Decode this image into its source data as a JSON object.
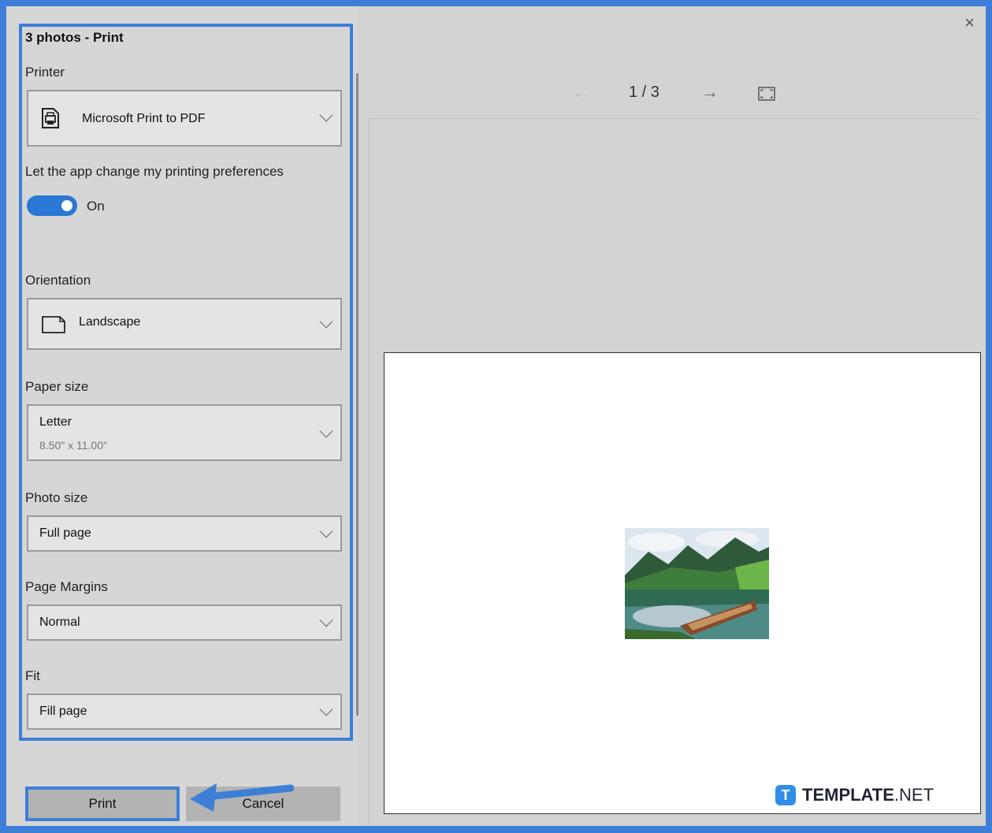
{
  "dialog": {
    "title": "3 photos - Print",
    "close": "×"
  },
  "printer": {
    "label": "Printer",
    "value": "Microsoft Print to PDF"
  },
  "preferences": {
    "label": "Let the app change my printing preferences",
    "toggle_state": "On"
  },
  "orientation": {
    "label": "Orientation",
    "value": "Landscape"
  },
  "paper_size": {
    "label": "Paper size",
    "value": "Letter",
    "detail": "8.50\" x 11.00\""
  },
  "photo_size": {
    "label": "Photo size",
    "value": "Full page"
  },
  "page_margins": {
    "label": "Page Margins",
    "value": "Normal"
  },
  "fit": {
    "label": "Fit",
    "value": "Fill page"
  },
  "buttons": {
    "print": "Print",
    "cancel": "Cancel"
  },
  "preview": {
    "page_indicator": "1 / 3",
    "prev": "←",
    "next": "→"
  },
  "branding": {
    "logo_letter": "T",
    "name_bold": "TEMPLATE",
    "name_suffix": ".NET"
  },
  "colors": {
    "accent": "#3d7fd6",
    "toggle": "#2a77d4",
    "brand": "#2f8ee8"
  }
}
